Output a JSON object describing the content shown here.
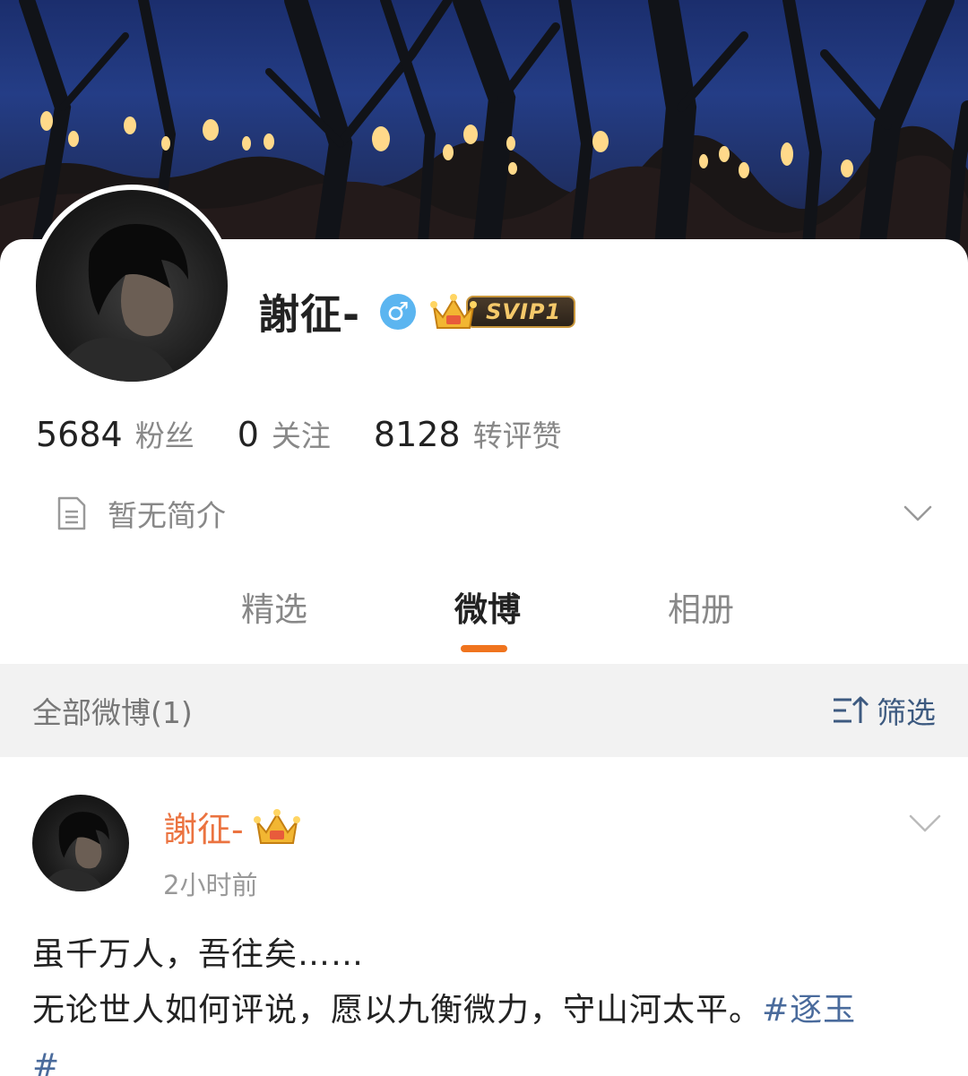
{
  "profile": {
    "username": "謝征-",
    "gender_icon": "male-icon",
    "gender_symbol": "♂",
    "vip_badge": "SVIP1",
    "stats": [
      {
        "value": "5684",
        "label": "粉丝"
      },
      {
        "value": "0",
        "label": "关注"
      },
      {
        "value": "8128",
        "label": "转评赞"
      }
    ],
    "bio": "暂无简介"
  },
  "tabs": [
    {
      "label": "精选",
      "active": false
    },
    {
      "label": "微博",
      "active": true
    },
    {
      "label": "相册",
      "active": false
    }
  ],
  "filter_bar": {
    "title": "全部微博(1)",
    "filter_label": "筛选"
  },
  "post": {
    "author": "謝征-",
    "time": "2小时前",
    "line1": "虽千万人，吾往矣……",
    "line2": "无论世人如何评说，愿以九衡微力，守山河太平。",
    "hashtag_part1": "#逐玉",
    "hashtag_part2": "#"
  },
  "colors": {
    "accent_orange": "#f0741e",
    "post_author": "#eb7340",
    "link_blue": "#4a6b9c",
    "gender_blue": "#5bb5f0",
    "svip_gold": "#f5c96a"
  }
}
